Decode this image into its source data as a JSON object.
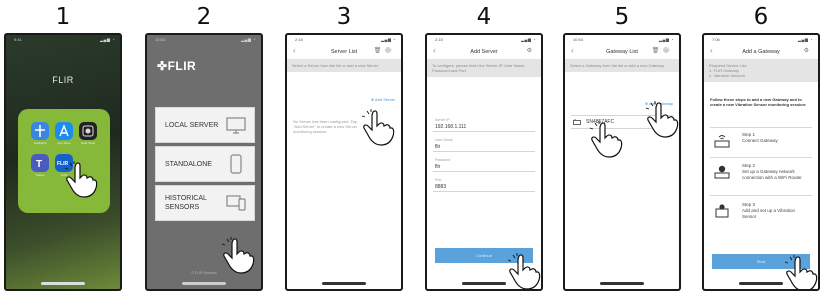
{
  "steps": [
    {
      "number": "1"
    },
    {
      "number": "2"
    },
    {
      "number": "3"
    },
    {
      "number": "4"
    },
    {
      "number": "5"
    },
    {
      "number": "6"
    }
  ],
  "screen1": {
    "folder_title": "FLIR",
    "apps": [
      "TestFlight",
      "App Store",
      "FLIR Tools",
      "Teams",
      "FLIR"
    ]
  },
  "screen2": {
    "logo": "FLIR",
    "menu": [
      "LOCAL SERVER",
      "STANDALONE",
      "HISTORICAL\nSENSORS"
    ],
    "footer": "© FLIR Systems"
  },
  "screen3": {
    "title": "Server List",
    "info": "Select a Server from the list or add a new Server",
    "add_label": "Add Server",
    "empty_text": "No Server has been configured. Tap \"Add Server\" to create a new Server monitoring session."
  },
  "screen4": {
    "title": "Add Server",
    "info": "To configure, please enter the Server IP, User Name, Password and Port.",
    "fields": [
      {
        "label": "Server IP",
        "value": "192.168.1.111"
      },
      {
        "label": "User Name",
        "value": "flir"
      },
      {
        "label": "Password",
        "value": "flir"
      },
      {
        "label": "Port",
        "value": "8883"
      }
    ],
    "button": "Continue"
  },
  "screen5": {
    "title": "Gateway List",
    "info": "Select a Gateway from the list or add a new Gateway",
    "add_label": "Add Gateway",
    "gateway": "SN4857AFC"
  },
  "screen6": {
    "title": "Add a Gateway",
    "info": "Required Device List:\n1. FLIR Gateway\n2. Vibration Sensors",
    "instructions": "Follow these steps to add a new Gateway and to create a new Vibration Sensor monitoring session:",
    "steps": [
      {
        "title": "Step 1",
        "text": "Connect Gateway"
      },
      {
        "title": "Step 2",
        "text": "Set up a Gateway network connection with a WiFi Router"
      },
      {
        "title": "Step 3",
        "text": "Add and set up a Vibration Sensor"
      }
    ],
    "button": "Start"
  },
  "colors": {
    "accent": "#5aa2dc",
    "folder": "#86b83a",
    "flir_bg": "#6e6e6e"
  }
}
